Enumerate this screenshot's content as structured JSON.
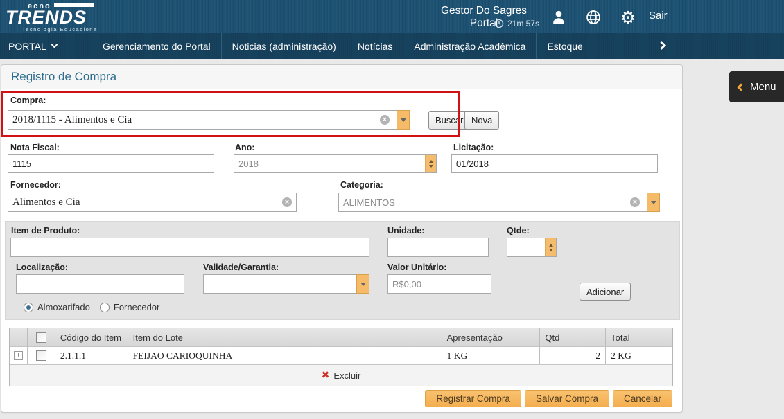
{
  "header": {
    "logo": {
      "small": "ecno",
      "big": "TRENDS",
      "tagline": "Tecnologia Educacional"
    },
    "portal_title": "Gestor Do Sagres Portal",
    "session_time": "21m 57s",
    "logout_label": "Sair",
    "icons": [
      "user-icon",
      "globe-icon",
      "gear-icon",
      "clock-icon"
    ]
  },
  "nav": {
    "portal_label": "PORTAL",
    "items": [
      "Gerenciamento do Portal",
      "Noticias (administração)",
      "Notícias",
      "Administração Acadêmica",
      "Estoque"
    ]
  },
  "menu_button": {
    "label": "Menu"
  },
  "page": {
    "title": "Registro de Compra"
  },
  "form": {
    "compra": {
      "label": "Compra:",
      "value": "2018/1115 - Alimentos e Cia"
    },
    "buscar_label": "Buscar",
    "nova_label": "Nova",
    "nota_fiscal": {
      "label": "Nota Fiscal:",
      "value": "1115"
    },
    "ano": {
      "label": "Ano:",
      "value": "2018"
    },
    "licitacao": {
      "label": "Licitação:",
      "value": "01/2018"
    },
    "fornecedor": {
      "label": "Fornecedor:",
      "value": "Alimentos e Cia"
    },
    "categoria": {
      "label": "Categoria:",
      "value": "ALIMENTOS"
    },
    "item_produto": {
      "label": "Item de Produto:",
      "value": ""
    },
    "unidade": {
      "label": "Unidade:",
      "value": ""
    },
    "qtde": {
      "label": "Qtde:",
      "value": ""
    },
    "localizacao": {
      "label": "Localização:",
      "value": ""
    },
    "validade": {
      "label": "Validade/Garantia:",
      "value": ""
    },
    "valor_unitario": {
      "label": "Valor Unitário:",
      "value": "R$0,00"
    },
    "adicionar_label": "Adicionar",
    "radios": {
      "almoxarifado": "Almoxarifado",
      "fornecedor": "Fornecedor",
      "selected": "Almoxarifado"
    }
  },
  "table": {
    "headers": [
      "Código do Item",
      "Item do Lote",
      "Apresentação",
      "Qtd",
      "Total"
    ],
    "rows": [
      {
        "codigo": "2.1.1.1",
        "item": "FEIJAO CARIOQUINHA",
        "apresentacao": "1 KG",
        "qtd": "2",
        "total": "2 KG"
      }
    ],
    "excluir_label": "Excluir"
  },
  "actions": {
    "registrar": "Registrar Compra",
    "salvar": "Salvar Compra",
    "cancelar": "Cancelar"
  },
  "colors": {
    "topbar_navy": "#1e5273",
    "navbar_navy": "#17425e",
    "accent_orange": "#f4ae4f",
    "highlight_red": "#d11212",
    "title_blue": "#2e6e8e",
    "delete_red": "#cf3326"
  }
}
